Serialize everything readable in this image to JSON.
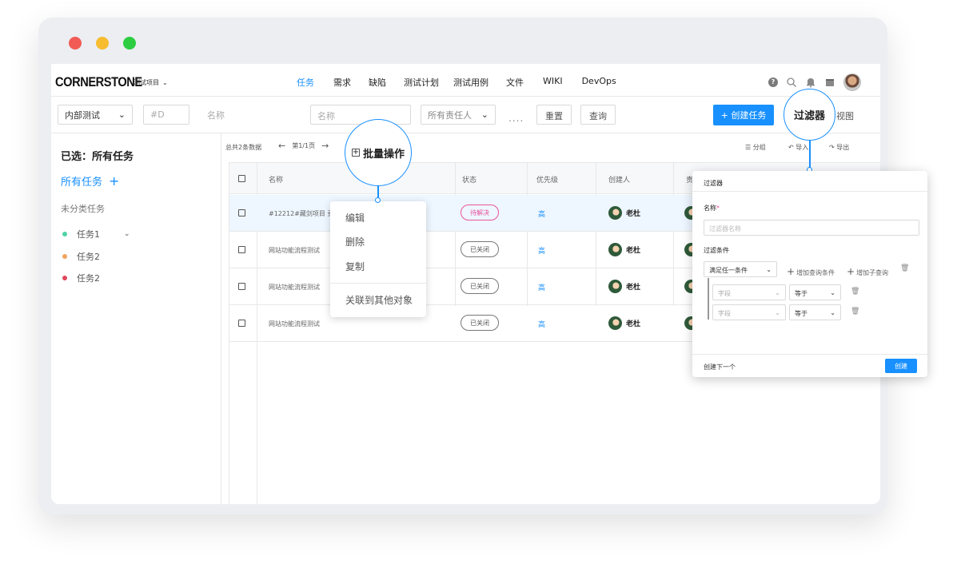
{
  "nav": {
    "logo": "CORNERSTONE",
    "project": "测试项目",
    "menu": [
      "任务",
      "需求",
      "缺陷",
      "测试计划",
      "测试用例",
      "文件",
      "WIKI",
      "DevOps"
    ],
    "help": "?"
  },
  "filters": {
    "group_select": "内部测试",
    "id_placeholder": "#D",
    "name_placeholder_1": "名称",
    "name_placeholder_2": "名称",
    "assignee_select": "所有责任人",
    "more": "....",
    "reset": "重置",
    "query": "查询",
    "create": "+ 创建任务",
    "view": "视图"
  },
  "sidebar": {
    "title": "已选：所有任务",
    "all": "所有任务",
    "plus": "+",
    "uncategorized": "未分类任务",
    "items": [
      {
        "label": "任务1",
        "color": "#4fd1a5"
      },
      {
        "label": "任务2",
        "color": "#f0a35e"
      },
      {
        "label": "任务2",
        "color": "#e0475a"
      }
    ]
  },
  "list": {
    "count": "总共2条数据",
    "page": "第1/1页",
    "batch": "批量操作",
    "group": "分组",
    "import": "导入",
    "export": "导出",
    "columns": [
      "名称",
      "状态",
      "优先级",
      "创建人",
      "责"
    ],
    "rows": [
      {
        "name": "#12212#藏剑项目 责",
        "status": "待解决",
        "priority": "高",
        "creator": "老杜"
      },
      {
        "name": "网站功能流程测试",
        "status": "已关闭",
        "priority": "高",
        "creator": "老杜"
      },
      {
        "name": "网站功能流程测试",
        "status": "已关闭",
        "priority": "高",
        "creator": "老杜"
      },
      {
        "name": "网站功能流程测试",
        "status": "已关闭",
        "priority": "高",
        "creator": "老杜"
      }
    ]
  },
  "context_menu": {
    "items": [
      "编辑",
      "删除",
      "复制",
      "关联到其他对象"
    ]
  },
  "callouts": {
    "batch": "批量操作",
    "filter": "过滤器"
  },
  "filter_panel": {
    "title": "过滤器",
    "name_label": "名称",
    "required": "*",
    "name_placeholder": "过滤器名称",
    "cond_label": "过滤条件",
    "match": "满足任一条件",
    "add_cond": "增加查询条件",
    "add_sub": "增加子查询",
    "rules": [
      {
        "field": "字段",
        "op": "等于"
      },
      {
        "field": "字段",
        "op": "等于"
      }
    ],
    "create_next": "创建下一个",
    "create": "创建"
  }
}
